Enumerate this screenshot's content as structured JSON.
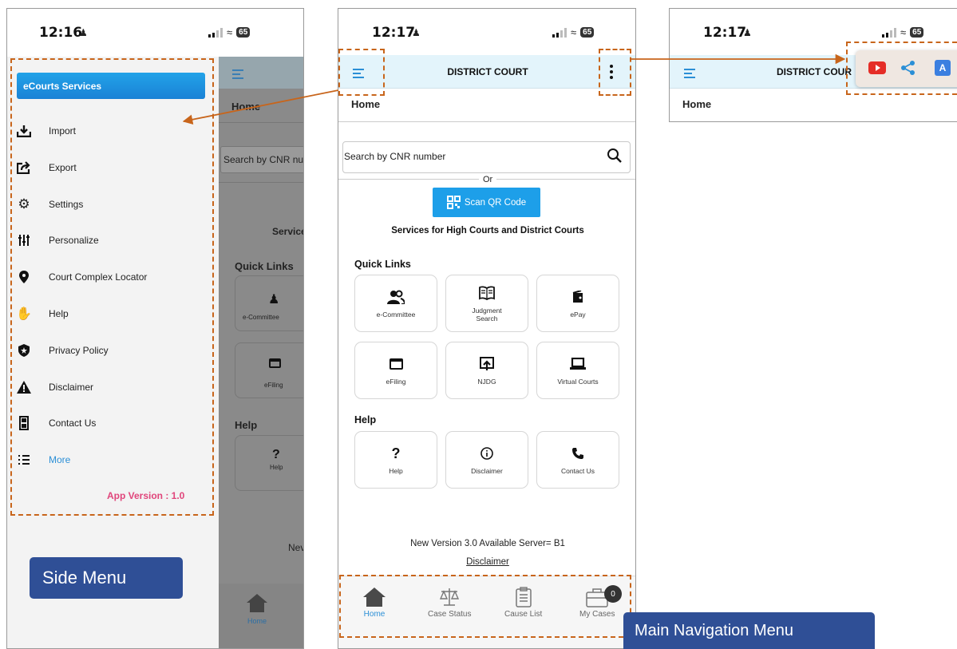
{
  "status_bar": [
    {
      "time": "12:16",
      "battery": "65"
    },
    {
      "time": "12:17",
      "battery": "65"
    },
    {
      "time": "12:17",
      "battery": "65"
    }
  ],
  "side_menu": {
    "header": "eCourts Services",
    "items": [
      {
        "label": "Import",
        "icon": "import-icon"
      },
      {
        "label": "Export",
        "icon": "export-icon"
      },
      {
        "label": "Settings",
        "icon": "gear-icon"
      },
      {
        "label": "Personalize",
        "icon": "sliders-icon"
      },
      {
        "label": "Court Complex Locator",
        "icon": "location-pin-icon"
      },
      {
        "label": "Help",
        "icon": "hand-icon"
      },
      {
        "label": "Privacy Policy",
        "icon": "shield-icon"
      },
      {
        "label": "Disclaimer",
        "icon": "warning-icon"
      },
      {
        "label": "Contact Us",
        "icon": "phone-icon"
      },
      {
        "label": "More",
        "icon": "list-icon"
      }
    ],
    "app_version": "App Version : 1.0",
    "callout": "Side Menu"
  },
  "behind_panel": {
    "breadcrumb": "Home",
    "search_placeholder": "Search by CNR nur",
    "services_heading": "Services",
    "quick_links": "Quick Links",
    "tiles": [
      "e-Committee",
      "eFiling"
    ],
    "help_heading": "Help",
    "help_tile": "Help",
    "version_fragment": "Nev",
    "nav_home": "Home"
  },
  "main": {
    "title": "DISTRICT COURT",
    "breadcrumb": "Home",
    "search_placeholder": "Search by CNR number",
    "or": "Or",
    "scan_button": "Scan QR Code",
    "services_heading": "Services for High Courts and District Courts",
    "quick_links_heading": "Quick Links",
    "quick_links": [
      {
        "label": "e-Committee",
        "icon": "users-icon"
      },
      {
        "label": "Judgment Search",
        "icon": "book-icon"
      },
      {
        "label": "ePay",
        "icon": "wallet-icon"
      },
      {
        "label": "eFiling",
        "icon": "browser-window-icon"
      },
      {
        "label": "NJDG",
        "icon": "upload-screen-icon"
      },
      {
        "label": "Virtual Courts",
        "icon": "laptop-icon"
      }
    ],
    "help_heading": "Help",
    "help_tiles": [
      {
        "label": "Help",
        "icon": "question-icon"
      },
      {
        "label": "Disclaimer",
        "icon": "info-icon"
      },
      {
        "label": "Contact Us",
        "icon": "phone-icon"
      }
    ],
    "version_text": "New Version 3.0 Available Server= B1",
    "disclaimer_link": "Disclaimer",
    "bottom_nav": [
      {
        "label": "Home",
        "icon": "home-icon",
        "active": true
      },
      {
        "label": "Case Status",
        "icon": "scales-icon"
      },
      {
        "label": "Cause List",
        "icon": "clipboard-icon"
      },
      {
        "label": "My Cases",
        "icon": "briefcase-icon",
        "badge": "0"
      }
    ],
    "nav_callout": "Main Navigation Menu"
  },
  "third": {
    "title": "DISTRICT COUR",
    "breadcrumb": "Home",
    "popup_icons": [
      "youtube-icon",
      "share-icon",
      "translate-icon"
    ]
  },
  "colors": {
    "accent": "#2b8fd6",
    "header_bg": "#e3f4fb",
    "callout_bg": "#2f4f96",
    "dash": "#c8651b",
    "version_pink": "#e0457b",
    "youtube_red": "#e52d27"
  }
}
